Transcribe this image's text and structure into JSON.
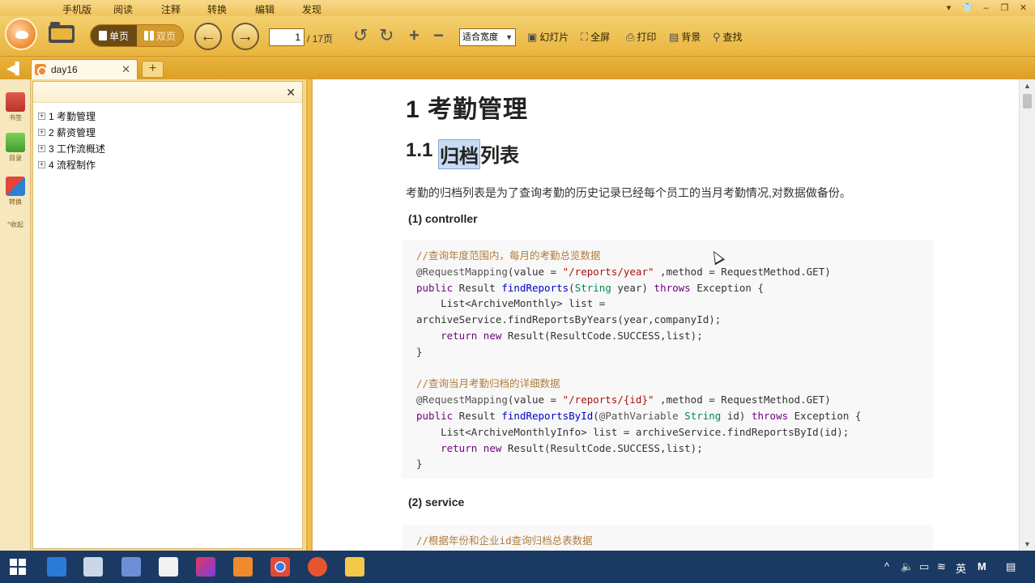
{
  "menu": [
    "手机版",
    "阅读",
    "注释",
    "转换",
    "编辑",
    "发现"
  ],
  "window_controls": [
    "▾",
    "shirt",
    "–",
    "❐",
    "✕"
  ],
  "toolbar": {
    "single_page_label": "单页",
    "double_page_label": "双页",
    "page_current": "1",
    "page_total": "/ 17页",
    "zoom_value": "适合宽度",
    "slideshow_label": "幻灯片",
    "fullscreen_label": "全屏",
    "print_label": "打印",
    "background_label": "背景",
    "find_label": "查找"
  },
  "tab": {
    "title": "day16",
    "close": "✕",
    "new": "+"
  },
  "rail": {
    "bookmark_label": "书签",
    "outline_label": "目录",
    "convert_label": "转换",
    "collapse_label": "^收起"
  },
  "sidebar": {
    "close": "✕",
    "items": [
      {
        "expander": "+",
        "label": "1 考勤管理"
      },
      {
        "expander": "+",
        "label": "2 薪资管理"
      },
      {
        "expander": "+",
        "label": "3 工作流概述"
      },
      {
        "expander": "+",
        "label": "4 流程制作"
      }
    ]
  },
  "document": {
    "h1": "1 考勤管理",
    "h2_prefix": "1.1 ",
    "h2_highlight": "归档",
    "h2_suffix": "列表",
    "paragraph": "考勤的归档列表是为了查询考勤的历史记录已经每个员工的当月考勤情况,对数据做备份。",
    "sub1": "(1) controller",
    "sub2": "(2) service",
    "code1": [
      "//查询年度范围内，每月的考勤总览数据",
      "@RequestMapping(value = \"/reports/year\" ,method = RequestMethod.GET)",
      "public Result findReports(String year) throws Exception {",
      "    List<ArchiveMonthly> list =",
      "archiveService.findReportsByYears(year,companyId);",
      "    return new Result(ResultCode.SUCCESS,list);",
      "}",
      "",
      "//查询当月考勤归档的详细数据",
      "@RequestMapping(value = \"/reports/{id}\" ,method = RequestMethod.GET)",
      "public Result findReportsById(@PathVariable String id) throws Exception {",
      "    List<ArchiveMonthlyInfo> list = archiveService.findReportsById(id);",
      "    return new Result(ResultCode.SUCCESS,list);",
      "}"
    ],
    "code2_first": "//根据年份和企业id查询归档总表数据"
  },
  "taskbar": {
    "tray_lang": "英",
    "tray_ime": "M"
  },
  "colors": {
    "accent": "#e9b43c",
    "menubar": "#f0c35d",
    "taskbar": "#1b3a63",
    "highlight": "#c7dcf2"
  }
}
